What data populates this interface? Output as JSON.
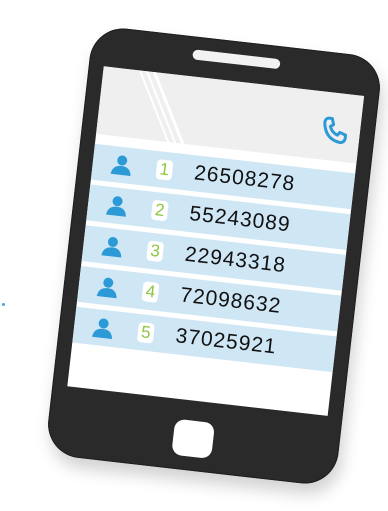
{
  "colors": {
    "phone_body": "#2a2a2a",
    "row_background": "#cfe6f5",
    "header_background": "#efefef",
    "icon_blue": "#2c9ad6",
    "badge_green": "#8dc63f"
  },
  "header": {
    "call_icon": "phone-handset-icon"
  },
  "contacts": [
    {
      "index": "1",
      "number": "26508278",
      "icon": "person-icon"
    },
    {
      "index": "2",
      "number": "55243089",
      "icon": "person-icon"
    },
    {
      "index": "3",
      "number": "22943318",
      "icon": "person-icon"
    },
    {
      "index": "4",
      "number": "72098632",
      "icon": "person-icon"
    },
    {
      "index": "5",
      "number": "37025921",
      "icon": "person-icon"
    }
  ]
}
